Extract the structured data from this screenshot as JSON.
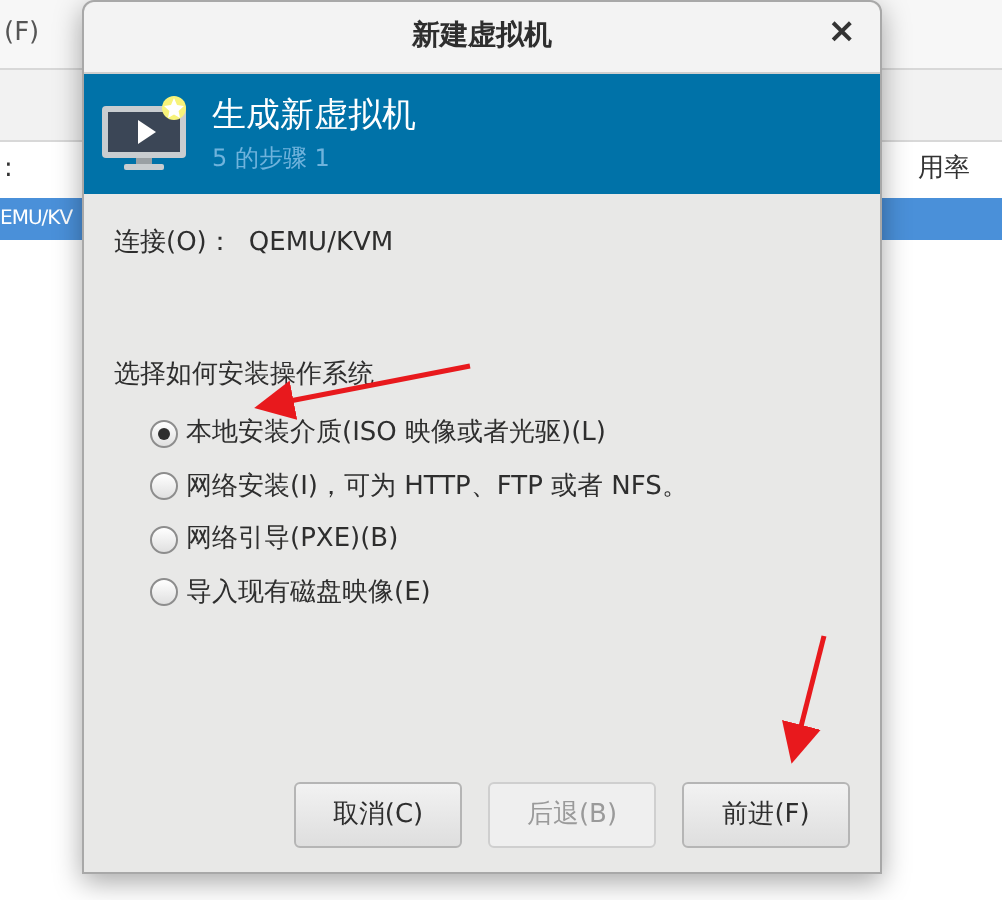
{
  "background_app": {
    "menu_label": "(F)",
    "column_header_left": ":",
    "column_header_right": "用率",
    "row": {
      "label": "EMU/KV",
      "selected": true
    }
  },
  "dialog": {
    "title": "新建虚拟机",
    "close": "×",
    "header": {
      "title": "生成新虚拟机",
      "step": "5 的步骤 1"
    },
    "connection": {
      "label": "连接(O)：",
      "value": "QEMU/KVM"
    },
    "prompt": "选择如何安装操作系统",
    "options": [
      {
        "label": "本地安装介质(ISO 映像或者光驱)(L)",
        "selected": true
      },
      {
        "label": "网络安装(I)，可为  HTTP、FTP 或者  NFS。",
        "selected": false
      },
      {
        "label": "网络引导(PXE)(B)",
        "selected": false
      },
      {
        "label": "导入现有磁盘映像(E)",
        "selected": false
      }
    ],
    "buttons": [
      {
        "label": "取消(C)",
        "disabled": false
      },
      {
        "label": "后退(B)",
        "disabled": true
      },
      {
        "label": "前进(F)",
        "disabled": false
      }
    ]
  }
}
